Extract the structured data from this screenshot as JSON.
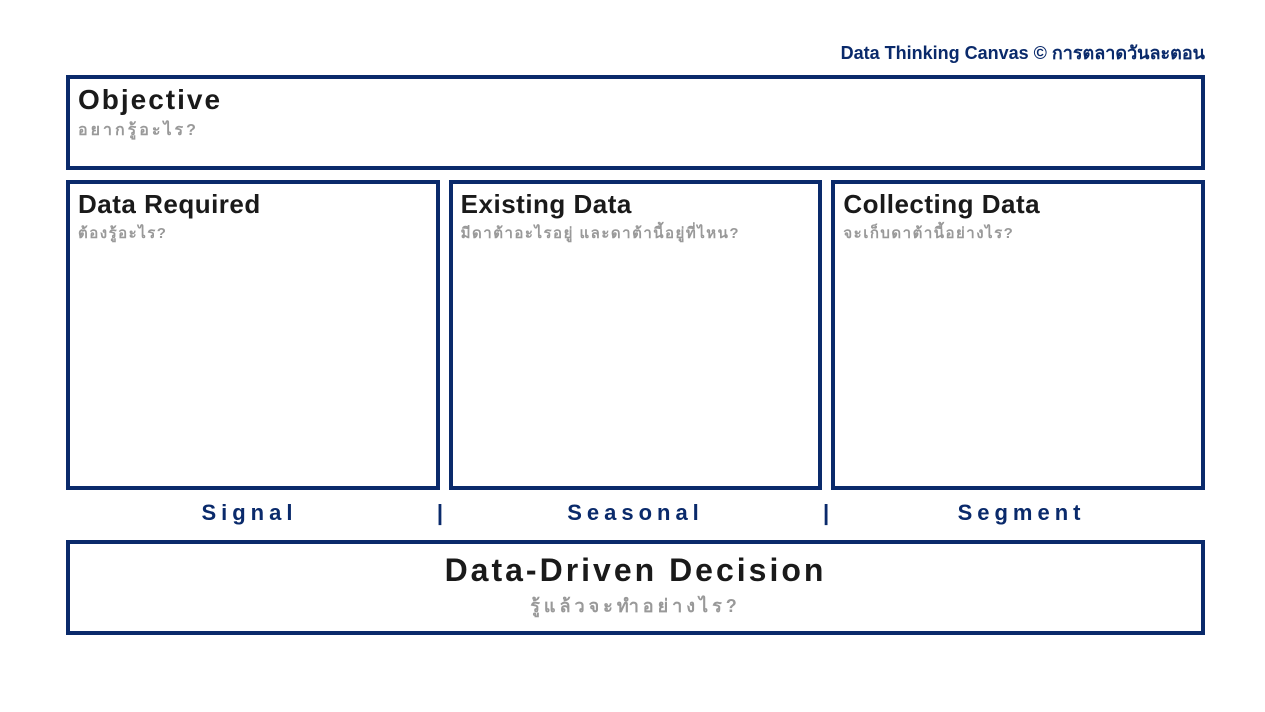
{
  "header": "Data Thinking Canvas © การตลาดวันละตอน",
  "objective": {
    "title": "Objective",
    "subtitle": "อยากรู้อะไร?"
  },
  "columns": [
    {
      "title": "Data Required",
      "subtitle": "ต้องรู้อะไร?"
    },
    {
      "title": "Existing Data",
      "subtitle": "มีดาต้าอะไรอยู่ และดาต้านี้อยู่ที่ไหน?"
    },
    {
      "title": "Collecting Data",
      "subtitle": "จะเก็บดาต้านี้อย่างไร?"
    }
  ],
  "labels": [
    "Signal",
    "Seasonal",
    "Segment"
  ],
  "separator": "|",
  "decision": {
    "title": "Data-Driven Decision",
    "subtitle": "รู้แล้วจะทำอย่างไร?"
  }
}
